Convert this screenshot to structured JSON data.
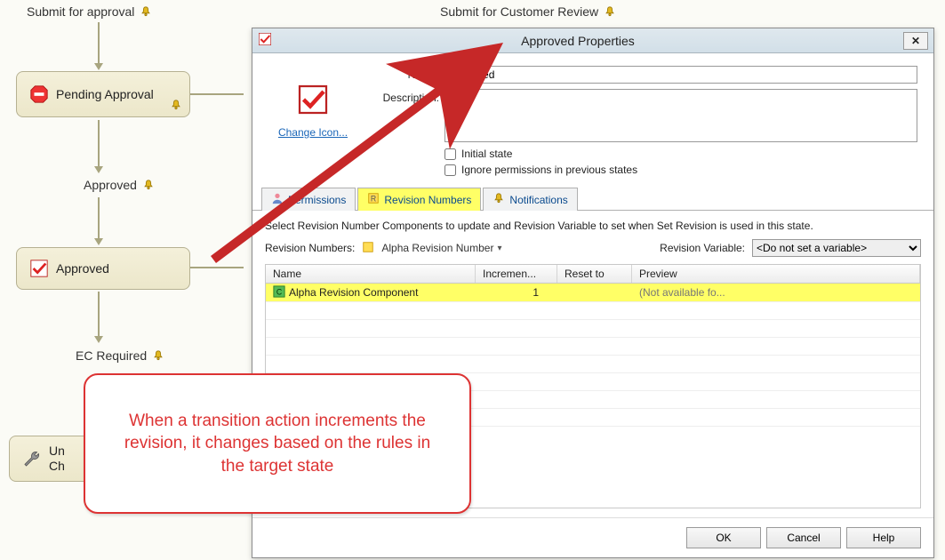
{
  "diagram": {
    "transitions": {
      "submit_approval": "Submit for approval",
      "submit_customer": "Submit for Customer Review",
      "approved_label": "Approved",
      "ec_required": "EC Required"
    },
    "nodes": {
      "pending_approval": "Pending Approval",
      "approved": "Approved",
      "under_change": "Under Change"
    }
  },
  "dialog": {
    "title": "Approved Properties",
    "change_icon": "Change Icon...",
    "fields": {
      "name_label": "Name:",
      "name_value": "Approved",
      "desc_label": "Description:",
      "desc_value": "",
      "initial_state": "Initial state",
      "ignore_perm": "Ignore permissions in previous states"
    },
    "tabs": {
      "permissions": "Permissions",
      "revision_numbers": "Revision Numbers",
      "notifications": "Notifications"
    },
    "rev": {
      "instruction": "Select Revision Number Components to update and Revision Variable to set when Set Revision is used in this state.",
      "rev_numbers_label": "Revision Numbers:",
      "rev_numbers_value": "Alpha Revision Number",
      "rev_var_label": "Revision Variable:",
      "rev_var_value": "<Do not set a variable>",
      "cols": {
        "name": "Name",
        "inc": "Incremen...",
        "reset": "Reset to",
        "prev": "Preview"
      },
      "rows": [
        {
          "name": "Alpha Revision Component",
          "inc": "1",
          "reset": "",
          "prev": "(Not available fo..."
        }
      ]
    },
    "buttons": {
      "ok": "OK",
      "cancel": "Cancel",
      "help": "Help"
    }
  },
  "callout": "When a transition action increments the revision, it changes based on the rules in the target state"
}
